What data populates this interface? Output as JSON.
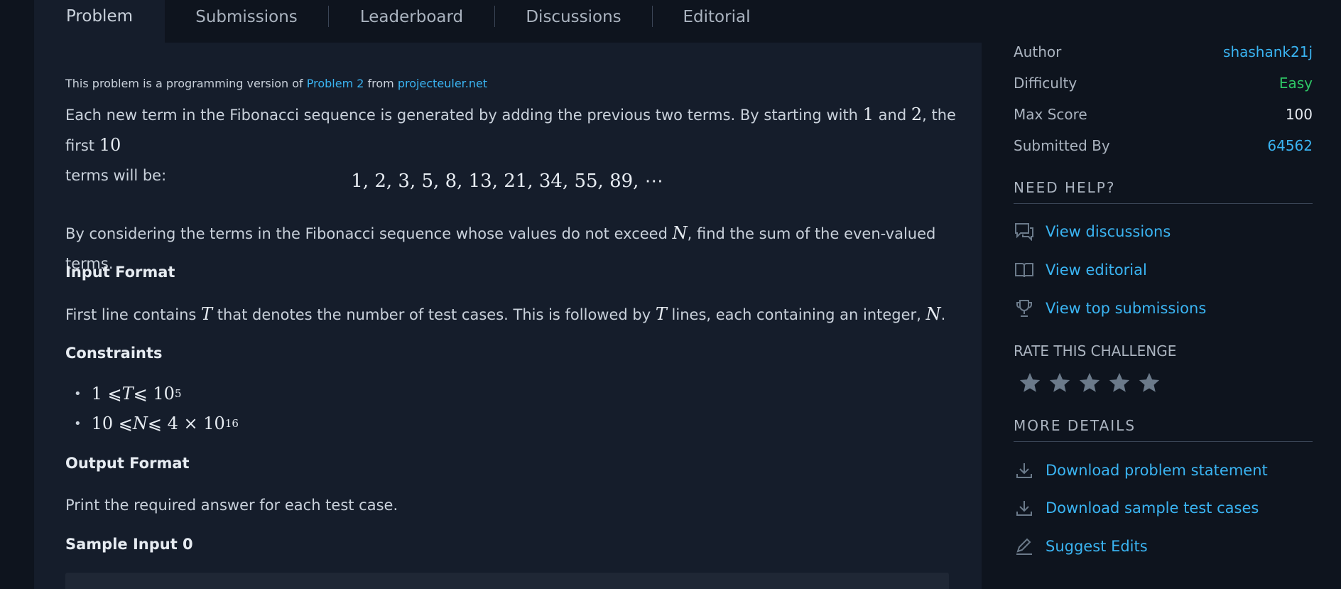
{
  "tabs": [
    {
      "label": "Problem",
      "active": true
    },
    {
      "label": "Submissions"
    },
    {
      "label": "Leaderboard"
    },
    {
      "label": "Discussions"
    },
    {
      "label": "Editorial"
    }
  ],
  "problem": {
    "note_prefix": "This problem is a programming version of",
    "note_link1": "Problem 2",
    "note_mid": "from",
    "note_link2": "projecteuler.net",
    "intro_a": "Each new term in the Fibonacci sequence is generated by adding the previous two terms. By starting with",
    "intro_m1": "1",
    "intro_b": "and",
    "intro_m2": "2",
    "intro_c": ", the first",
    "intro_m3": "10",
    "intro_d": "terms will be:",
    "sequence": "1, 2, 3, 5, 8, 13, 21, 34, 55, 89, ⋯",
    "consider_a": "By considering the terms in the Fibonacci sequence whose values do not exceed",
    "consider_m": "N",
    "consider_b": ", find the sum of the even-valued terms.",
    "input_format_heading": "Input Format",
    "input_a": "First line contains",
    "input_m1": "T",
    "input_b": "that denotes the number of test cases. This is followed by",
    "input_m2": "T",
    "input_c": "lines, each containing an integer,",
    "input_m3": "N",
    "input_d": ".",
    "constraints_heading": "Constraints",
    "constraint1": {
      "lhs": "1 ⩽ ",
      "var": "T",
      "rhs": " ⩽ 10",
      "exp": "5"
    },
    "constraint2": {
      "lhs": "10 ⩽ ",
      "var": "N",
      "rhs": " ⩽ 4 × 10",
      "exp": "16"
    },
    "output_format_heading": "Output Format",
    "output_text": "Print the required answer for each test case.",
    "sample_input_heading": "Sample Input 0"
  },
  "sidebar": {
    "author_label": "Author",
    "author_value": "shashank21j",
    "difficulty_label": "Difficulty",
    "difficulty_value": "Easy",
    "maxscore_label": "Max Score",
    "maxscore_value": "100",
    "submitted_label": "Submitted By",
    "submitted_value": "64562",
    "need_help_title": "NEED HELP?",
    "view_discussions": "View discussions",
    "view_editorial": "View editorial",
    "view_top_submissions": "View top submissions",
    "rate_title": "RATE THIS CHALLENGE",
    "rating": {
      "max": 5,
      "filled": 0
    },
    "more_details_title": "MORE DETAILS",
    "download_statement": "Download problem statement",
    "download_samples": "Download sample test cases",
    "suggest_edits": "Suggest Edits"
  },
  "colors": {
    "link": "#3ab4f2",
    "easy": "#2ec866",
    "background": "#0e141e",
    "panel": "#151d2b",
    "star": "#6b7a8a"
  }
}
